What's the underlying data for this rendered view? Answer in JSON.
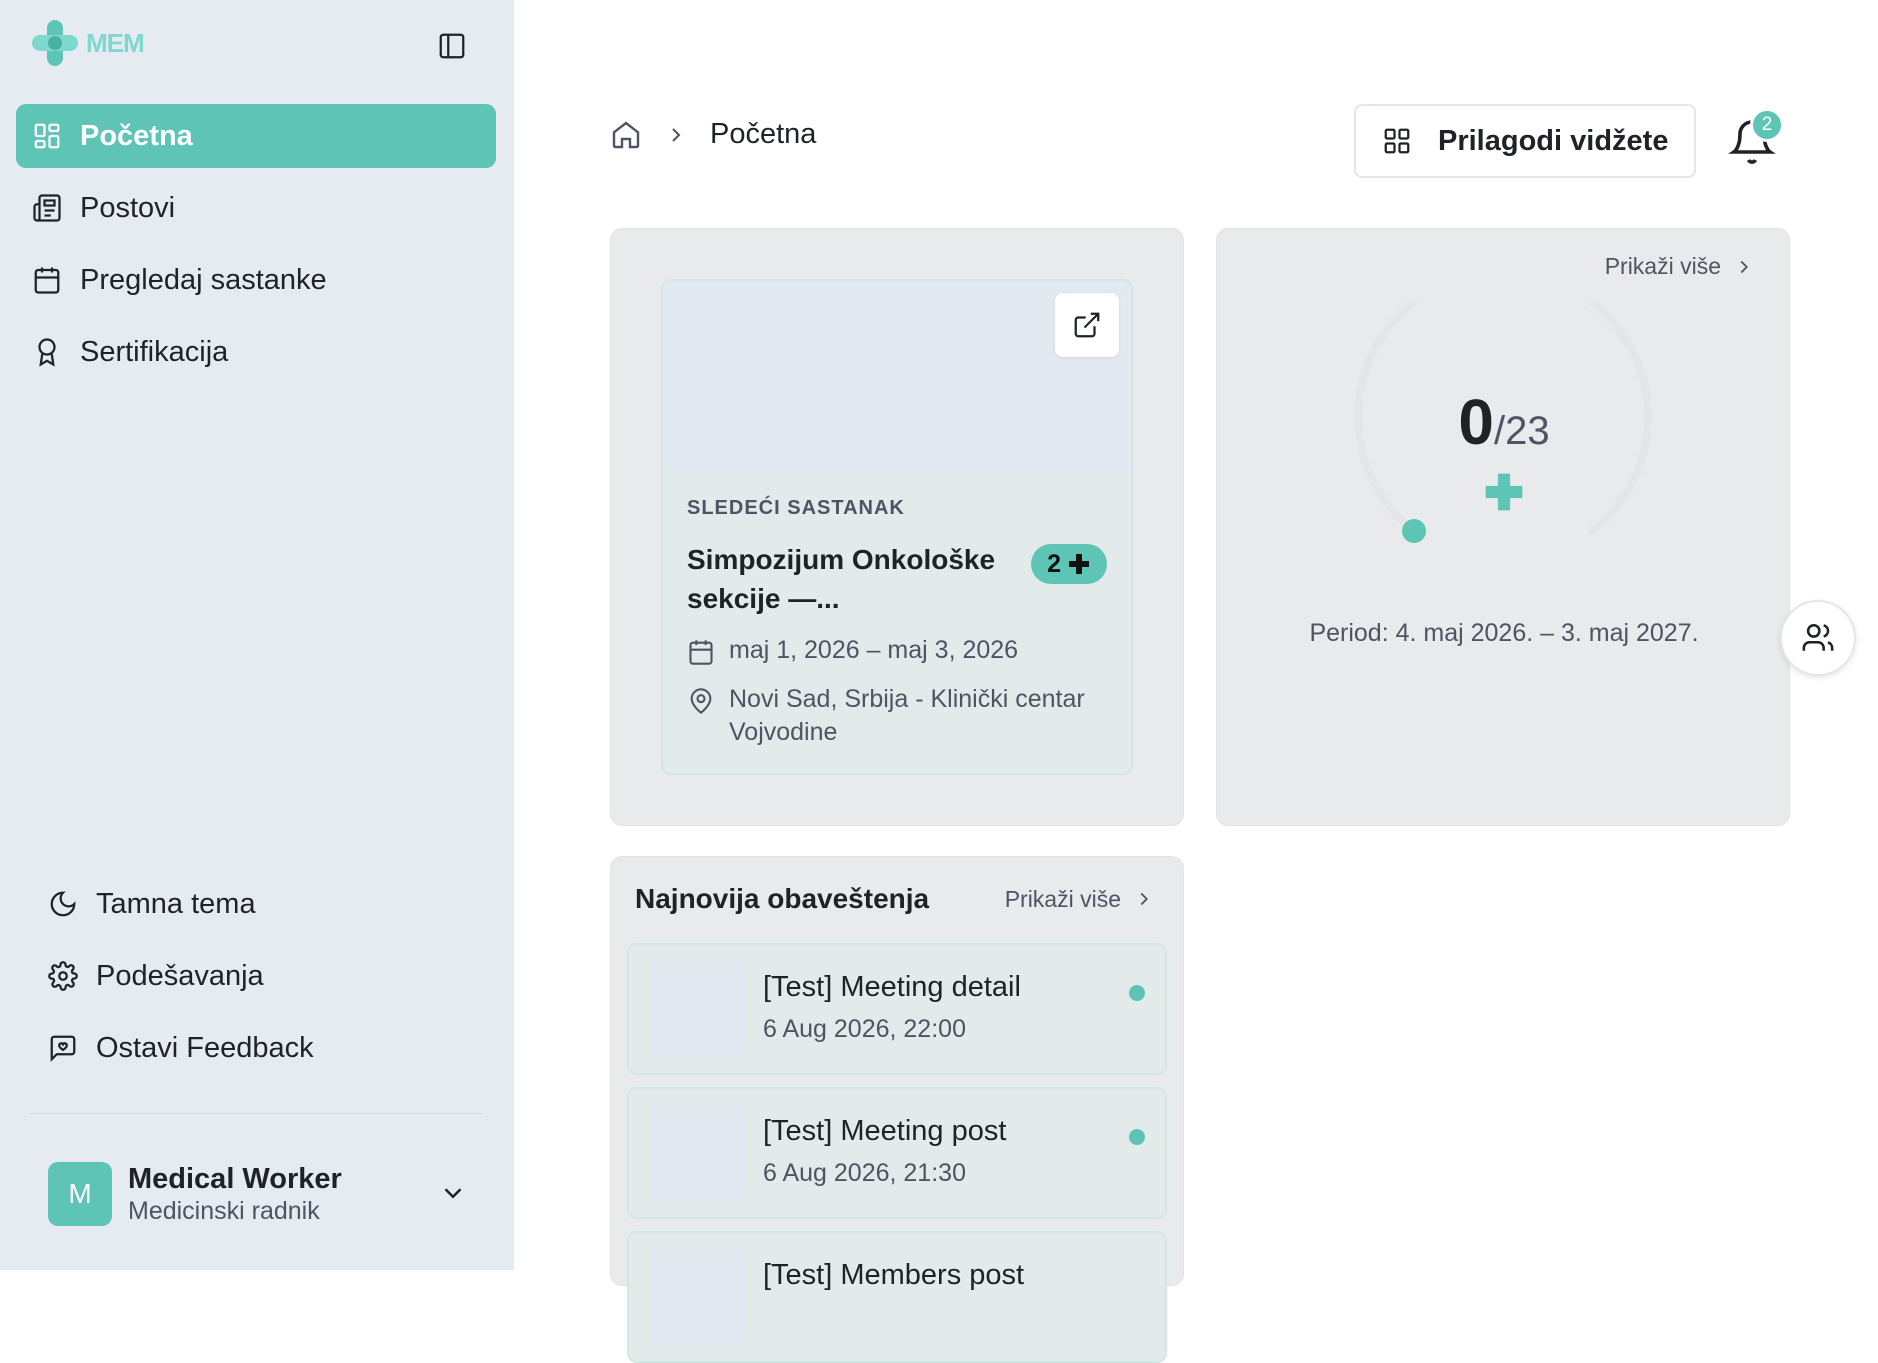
{
  "app": {
    "logo_text": "MEM"
  },
  "sidebar": {
    "items": [
      {
        "label": "Početna",
        "icon": "dashboard-icon",
        "active": true
      },
      {
        "label": "Postovi",
        "icon": "newspaper-icon"
      },
      {
        "label": "Pregledaj sastanke",
        "icon": "calendar-icon"
      },
      {
        "label": "Sertifikacija",
        "icon": "award-icon"
      }
    ],
    "bottom_items": [
      {
        "label": "Tamna tema",
        "icon": "moon-icon"
      },
      {
        "label": "Podešavanja",
        "icon": "gear-icon"
      },
      {
        "label": "Ostavi Feedback",
        "icon": "feedback-icon"
      }
    ],
    "user": {
      "initial": "M",
      "name": "Medical Worker",
      "role": "Medicinski radnik"
    }
  },
  "header": {
    "breadcrumb_current": "Početna",
    "customize_label": "Prilagodi vidžete",
    "notifications_count": "2"
  },
  "meeting_card": {
    "kicker": "SLEDEĆI SASTANAK",
    "title": "Simpozijum Onkološke sekcije —...",
    "points": "2",
    "dates": "maj 1, 2026 – maj 3, 2026",
    "location": "Novi Sad, Srbija - Klinički centar Vojvodine"
  },
  "points_card": {
    "show_more": "Prikaži više",
    "current": "0",
    "total": "/23",
    "progress_fraction": 0,
    "period": "Period: 4. maj 2026. – 3. maj 2027."
  },
  "notifications": {
    "title": "Najnovija obaveštenja",
    "show_more": "Prikaži više",
    "items": [
      {
        "title": "[Test] Meeting detail",
        "date": "6 Aug 2026, 22:00",
        "unread": true
      },
      {
        "title": "[Test] Meeting post",
        "date": "6 Aug 2026, 21:30",
        "unread": true
      },
      {
        "title": "[Test] Members post",
        "date": "",
        "unread": false
      }
    ]
  },
  "colors": {
    "accent": "#5ec4b6",
    "sidebar_bg": "#e6ebf2",
    "card_bg": "#e9eaec"
  }
}
